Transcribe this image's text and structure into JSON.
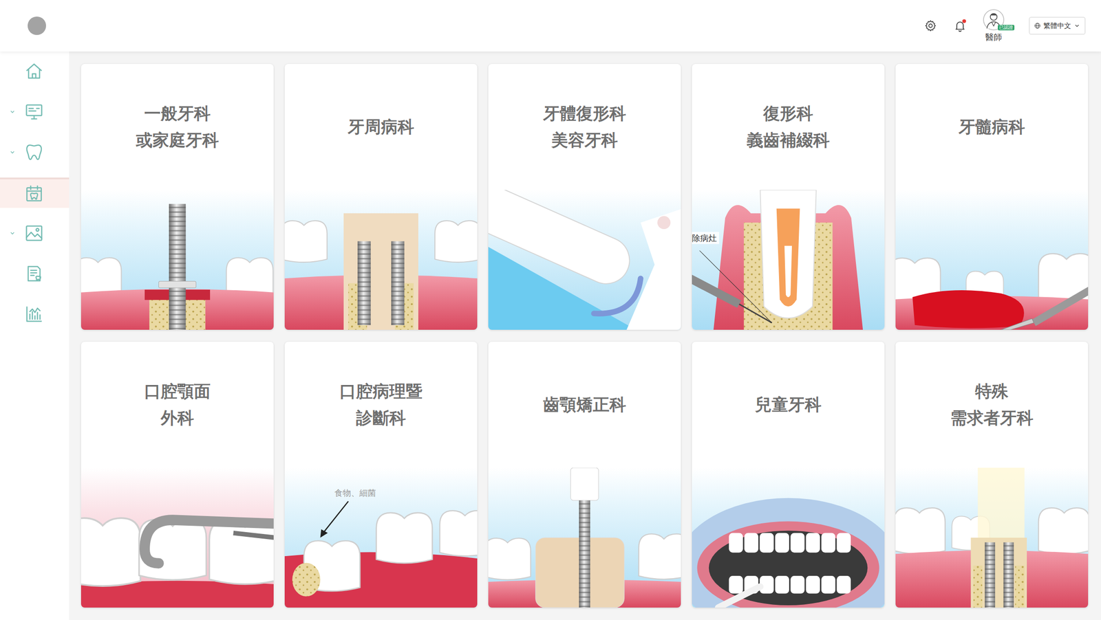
{
  "header": {
    "notifications": {
      "unread": true
    },
    "user": {
      "role": "醫師",
      "badge": "已認證"
    },
    "language": {
      "label": "繁體中文"
    }
  },
  "sidebar": {
    "items": [
      {
        "kind": "home",
        "expandable": false,
        "selected": false
      },
      {
        "kind": "monitor",
        "expandable": true,
        "selected": false
      },
      {
        "kind": "tooth",
        "expandable": true,
        "selected": false
      },
      {
        "kind": "calendar",
        "expandable": false,
        "selected": true
      },
      {
        "kind": "image",
        "expandable": true,
        "selected": false
      },
      {
        "kind": "document",
        "expandable": false,
        "selected": false
      },
      {
        "kind": "chart",
        "expandable": false,
        "selected": false
      }
    ]
  },
  "cards": [
    {
      "title": [
        "一般牙科",
        "或家庭牙科"
      ],
      "kind": "implant",
      "label": ""
    },
    {
      "title": [
        "牙周病科"
      ],
      "kind": "periodontal",
      "label": ""
    },
    {
      "title": [
        "牙體復形科",
        "美容牙科"
      ],
      "kind": "restorative",
      "label": ""
    },
    {
      "title": [
        "復形科",
        "義齒補綴科"
      ],
      "kind": "prosthodontic",
      "label": "除病灶"
    },
    {
      "title": [
        "牙髓病科"
      ],
      "kind": "endodontic",
      "label": ""
    },
    {
      "title": [
        "口腔顎面",
        "外科"
      ],
      "kind": "surgery",
      "label": ""
    },
    {
      "title": [
        "口腔病理暨",
        "診斷科"
      ],
      "kind": "pathology",
      "label": "食物、細菌"
    },
    {
      "title": [
        "齒顎矯正科"
      ],
      "kind": "orthodontic",
      "label": ""
    },
    {
      "title": [
        "兒童牙科"
      ],
      "kind": "pediatric",
      "label": ""
    },
    {
      "title": [
        "特殊",
        "需求者牙科"
      ],
      "kind": "special",
      "label": ""
    }
  ]
}
